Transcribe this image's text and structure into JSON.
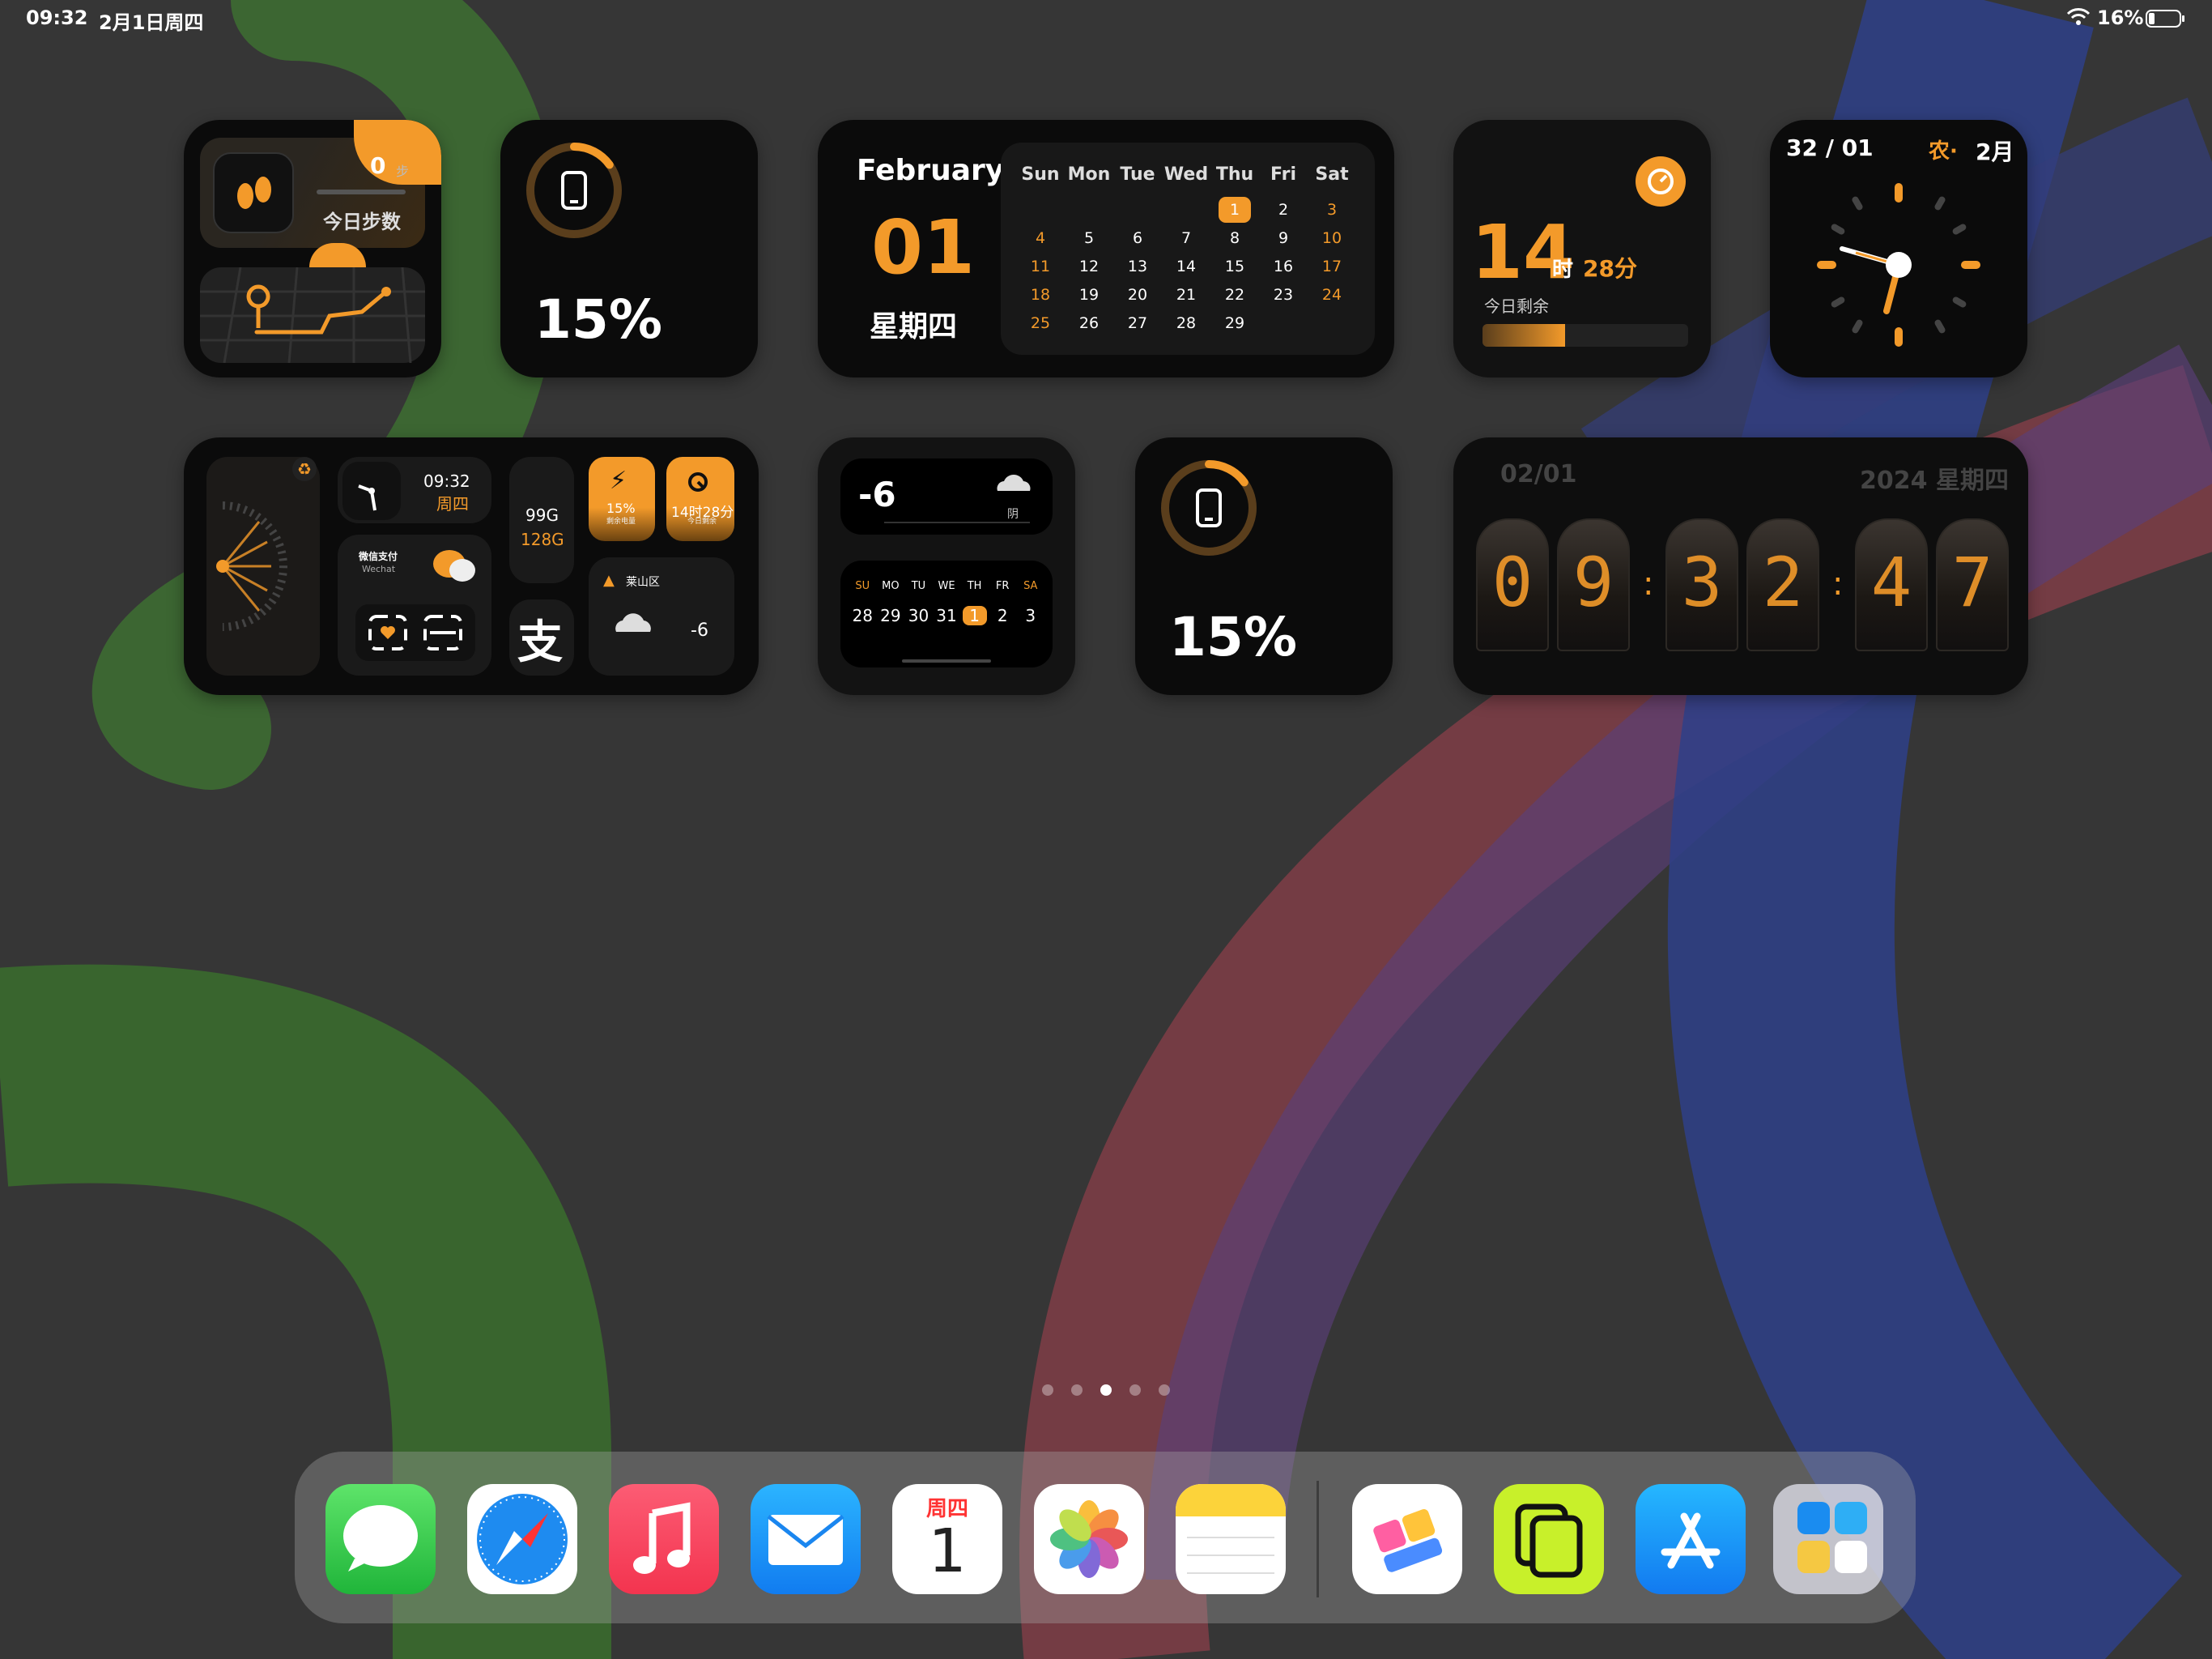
{
  "status_bar": {
    "time": "09:32",
    "date": "2月1日周四",
    "battery": "16%"
  },
  "steps_widget": {
    "count": "0",
    "unit": "步",
    "label": "今日步数"
  },
  "battery_widget_1": {
    "percent": "15%",
    "level": 0.15
  },
  "calendar_widget": {
    "month": "February",
    "day": "01",
    "weekday": "星期四",
    "headers": [
      "Sun",
      "Mon",
      "Tue",
      "Wed",
      "Thu",
      "Fri",
      "Sat"
    ],
    "weeks": [
      [
        "",
        "",
        "",
        "",
        "1",
        "2",
        "3"
      ],
      [
        "4",
        "5",
        "6",
        "7",
        "8",
        "9",
        "10"
      ],
      [
        "11",
        "12",
        "13",
        "14",
        "15",
        "16",
        "17"
      ],
      [
        "18",
        "19",
        "20",
        "21",
        "22",
        "23",
        "24"
      ],
      [
        "25",
        "26",
        "27",
        "28",
        "29",
        "",
        ""
      ]
    ],
    "today": "1"
  },
  "time_left_widget": {
    "hours": "14",
    "hours_unit": "时",
    "minutes": "28分",
    "label": "今日剩余",
    "progress": 0.4
  },
  "clock_widget": {
    "date": "32 / 01",
    "lunar": "农·",
    "lunar_month": "2月"
  },
  "combo_widget": {
    "time": "09:32",
    "weekday": "周四",
    "storage_free": "99G",
    "storage_total": "128G",
    "pay_title": "微信支付",
    "pay_sub": "Wechat",
    "battery": "15%",
    "battery_sub": "剩余电量",
    "time_left": "14时28分",
    "time_left_sub": "今日剩余",
    "location": "莱山区",
    "temp": "-6",
    "alipay": "支"
  },
  "weather_widget": {
    "temp": "-6",
    "condition": "阴",
    "week_headers": [
      "SU",
      "MO",
      "TU",
      "WE",
      "TH",
      "FR",
      "SA"
    ],
    "week_days": [
      "28",
      "29",
      "30",
      "31",
      "1",
      "2",
      "3"
    ],
    "today": "1"
  },
  "battery_widget_2": {
    "percent": "15%",
    "level": 0.15
  },
  "nixie_widget": {
    "date": "02/01",
    "year_weekday": "2024 星期四",
    "digits": [
      "0",
      "9",
      "3",
      "2",
      "4",
      "7"
    ]
  },
  "page_dots": {
    "count": 5,
    "active": 2
  },
  "dock": {
    "apps": [
      {
        "name": "messages-icon"
      },
      {
        "name": "safari-icon"
      },
      {
        "name": "music-icon"
      },
      {
        "name": "mail-icon"
      },
      {
        "name": "calendar-icon",
        "weekday": "周四",
        "day": "1"
      },
      {
        "name": "photos-icon"
      },
      {
        "name": "notes-icon"
      },
      {
        "name": "widget-app-icon"
      },
      {
        "name": "widget-ui-icon"
      },
      {
        "name": "app-store-icon"
      },
      {
        "name": "app-library-icon"
      }
    ]
  },
  "colors": {
    "accent": "#f39a2a",
    "widget_bg": "#0b0b0b",
    "panel": "#1a1a1a"
  }
}
